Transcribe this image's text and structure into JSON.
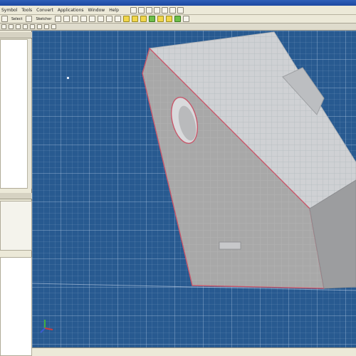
{
  "window": {
    "title": ""
  },
  "menu": {
    "items": [
      "Symbol",
      "Tools",
      "Convert",
      "Applications",
      "Window",
      "Help"
    ]
  },
  "toolbar": {
    "items": [
      "Select",
      "Sketcher"
    ]
  },
  "viewport": {
    "background": "#285a90",
    "model_face_color": "#a8a8a8",
    "model_top_color": "#cfd1d4",
    "edge_highlight": "#c8576a"
  },
  "icons": {
    "triad": "coordinate-triad-icon"
  }
}
